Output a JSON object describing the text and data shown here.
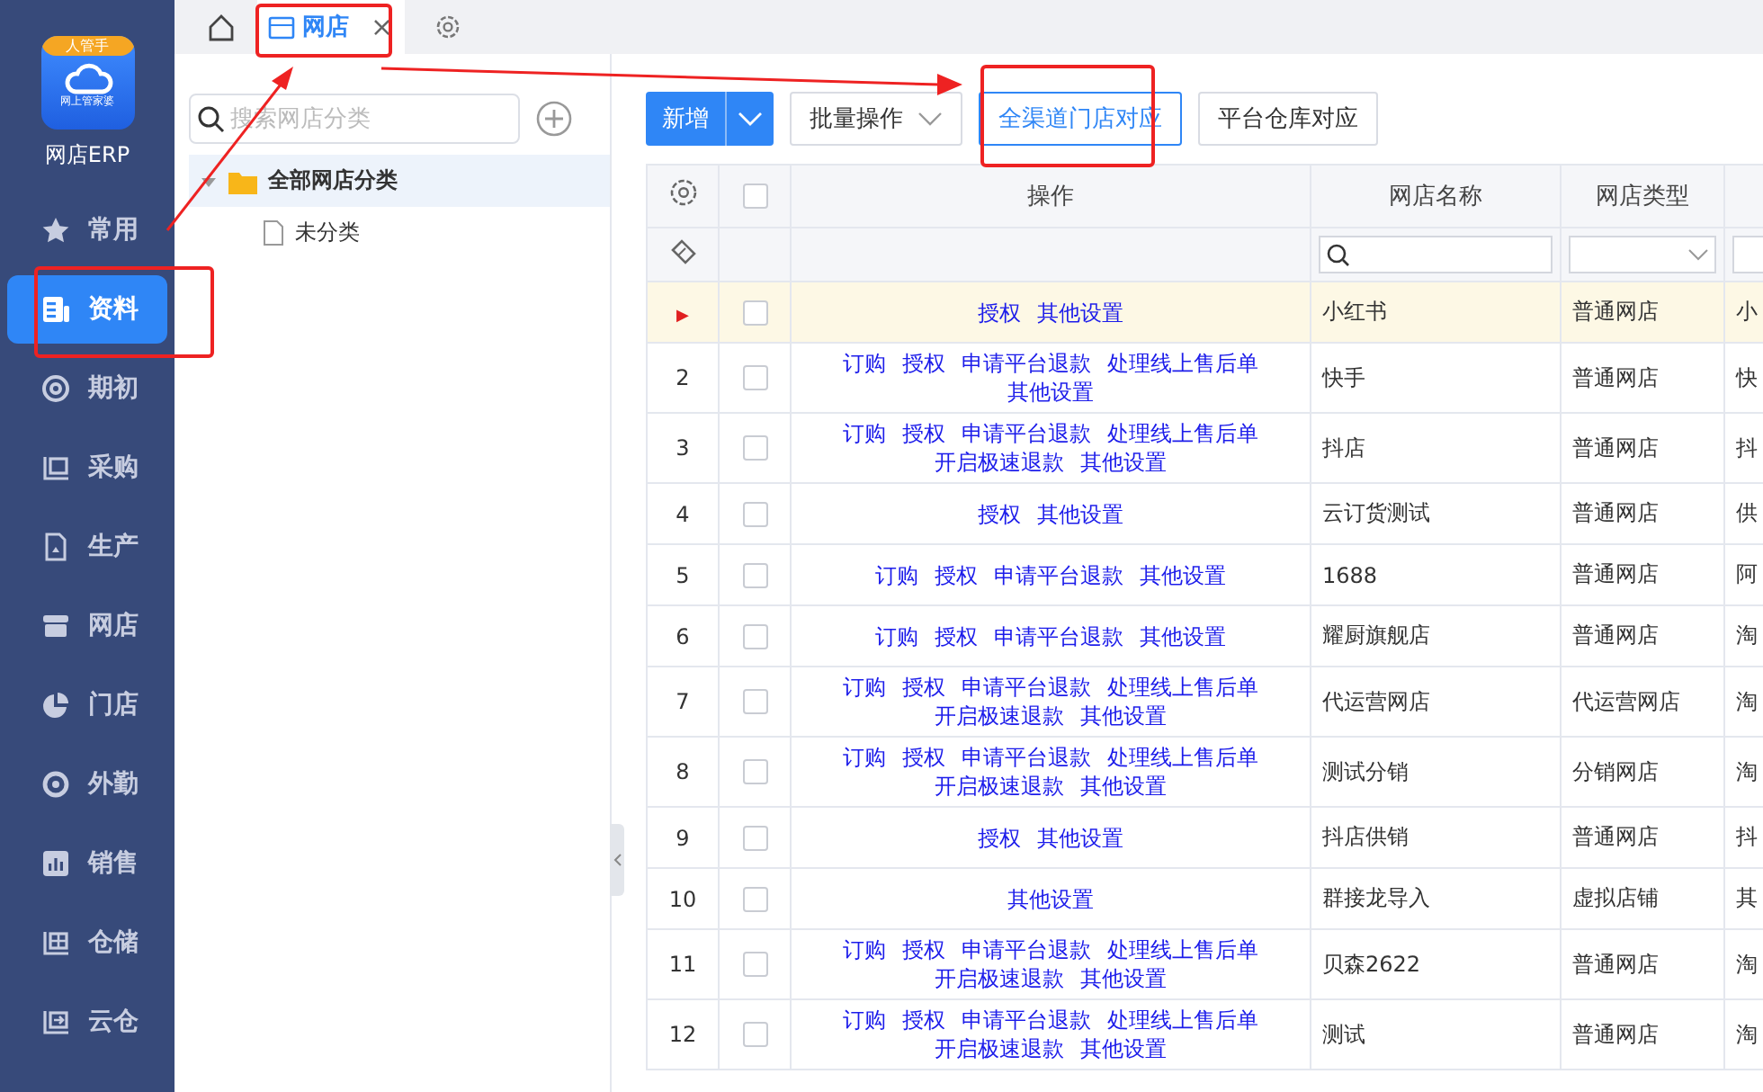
{
  "sidebar": {
    "logo": {
      "badge": "人管手",
      "caption": "网上管家婆"
    },
    "app_name": "网店ERP",
    "items": [
      {
        "label": "常用",
        "selected": false
      },
      {
        "label": "资料",
        "selected": true
      },
      {
        "label": "期初",
        "selected": false
      },
      {
        "label": "采购",
        "selected": false
      },
      {
        "label": "生产",
        "selected": false
      },
      {
        "label": "网店",
        "selected": false
      },
      {
        "label": "门店",
        "selected": false
      },
      {
        "label": "外勤",
        "selected": false
      },
      {
        "label": "销售",
        "selected": false
      },
      {
        "label": "仓储",
        "selected": false
      },
      {
        "label": "云仓",
        "selected": false
      }
    ]
  },
  "tabs": [
    {
      "label": "网店",
      "selected": true,
      "close": "×"
    }
  ],
  "tree": {
    "search": {
      "placeholder": "搜索网店分类"
    },
    "items": [
      {
        "label": "全部网店分类",
        "selected": true,
        "expanded": true,
        "children": [
          {
            "label": "未分类",
            "selected": false
          }
        ]
      }
    ]
  },
  "toolbar": {
    "buttons": [
      {
        "kind": "split",
        "label": "新增"
      },
      {
        "kind": "dropdown",
        "label": "批量操作"
      },
      {
        "kind": "outline",
        "label": "全渠道门店对应"
      },
      {
        "kind": "plain",
        "label": "平台仓库对应"
      }
    ]
  },
  "table": {
    "columns": [
      {
        "label": "操作",
        "kind": "actions"
      },
      {
        "label": "网店名称",
        "kind": "search"
      },
      {
        "label": "网店类型",
        "kind": "select"
      },
      {
        "kind": "text"
      }
    ],
    "header_checked": false,
    "rows": [
      {
        "marker": "▶",
        "current": true,
        "checked": false,
        "actions": [
          "授权",
          "其他设置"
        ],
        "name": "小红书",
        "type": "普通网店",
        "column_3": "小"
      },
      {
        "marker": "2",
        "current": false,
        "checked": false,
        "actions": [
          "订购",
          "授权",
          "申请平台退款",
          "处理线上售后单",
          "其他设置"
        ],
        "name": "快手",
        "type": "普通网店",
        "column_3": "快"
      },
      {
        "marker": "3",
        "current": false,
        "checked": false,
        "actions": [
          "订购",
          "授权",
          "申请平台退款",
          "处理线上售后单",
          "开启极速退款",
          "其他设置"
        ],
        "name": "抖店",
        "type": "普通网店",
        "column_3": "抖"
      },
      {
        "marker": "4",
        "current": false,
        "checked": false,
        "actions": [
          "授权",
          "其他设置"
        ],
        "name": "云订货测试",
        "type": "普通网店",
        "column_3": "供"
      },
      {
        "marker": "5",
        "current": false,
        "checked": false,
        "actions": [
          "订购",
          "授权",
          "申请平台退款",
          "其他设置"
        ],
        "name": "1688",
        "type": "普通网店",
        "column_3": "阿"
      },
      {
        "marker": "6",
        "current": false,
        "checked": false,
        "actions": [
          "订购",
          "授权",
          "申请平台退款",
          "其他设置"
        ],
        "name": "耀厨旗舰店",
        "type": "普通网店",
        "column_3": "淘"
      },
      {
        "marker": "7",
        "current": false,
        "checked": false,
        "actions": [
          "订购",
          "授权",
          "申请平台退款",
          "处理线上售后单",
          "开启极速退款",
          "其他设置"
        ],
        "name": "代运营网店",
        "type": "代运营网店",
        "column_3": "淘"
      },
      {
        "marker": "8",
        "current": false,
        "checked": false,
        "actions": [
          "订购",
          "授权",
          "申请平台退款",
          "处理线上售后单",
          "开启极速退款",
          "其他设置"
        ],
        "name": "测试分销",
        "type": "分销网店",
        "column_3": "淘"
      },
      {
        "marker": "9",
        "current": false,
        "checked": false,
        "actions": [
          "授权",
          "其他设置"
        ],
        "name": "抖店供销",
        "type": "普通网店",
        "column_3": "抖"
      },
      {
        "marker": "10",
        "current": false,
        "checked": false,
        "actions": [
          "其他设置"
        ],
        "name": "群接龙导入",
        "type": "虚拟店铺",
        "column_3": "其"
      },
      {
        "marker": "11",
        "current": false,
        "checked": false,
        "actions": [
          "订购",
          "授权",
          "申请平台退款",
          "处理线上售后单",
          "开启极速退款",
          "其他设置"
        ],
        "name": "贝森2622",
        "type": "普通网店",
        "column_3": "淘"
      },
      {
        "marker": "12",
        "current": false,
        "checked": false,
        "actions": [
          "订购",
          "授权",
          "申请平台退款",
          "处理线上售后单",
          "开启极速退款",
          "其他设置"
        ],
        "name": "测试",
        "type": "普通网店",
        "column_3": "淘"
      }
    ]
  }
}
